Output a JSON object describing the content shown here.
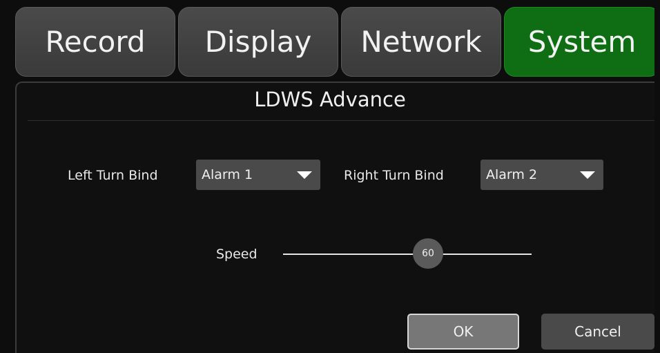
{
  "tabs": [
    {
      "label": "Record",
      "active": false
    },
    {
      "label": "Display",
      "active": false
    },
    {
      "label": "Network",
      "active": false
    },
    {
      "label": "System",
      "active": true
    }
  ],
  "panel": {
    "title": "LDWS Advance"
  },
  "left_turn_bind": {
    "label": "Left Turn Bind",
    "value": "Alarm 1"
  },
  "right_turn_bind": {
    "label": "Right Turn Bind",
    "value": "Alarm 2"
  },
  "speed": {
    "label": "Speed",
    "value": "60"
  },
  "buttons": {
    "ok": "OK",
    "cancel": "Cancel"
  },
  "colors": {
    "active_tab": "#0f6e14",
    "tab": "#444444",
    "background": "#0d0d0d"
  }
}
